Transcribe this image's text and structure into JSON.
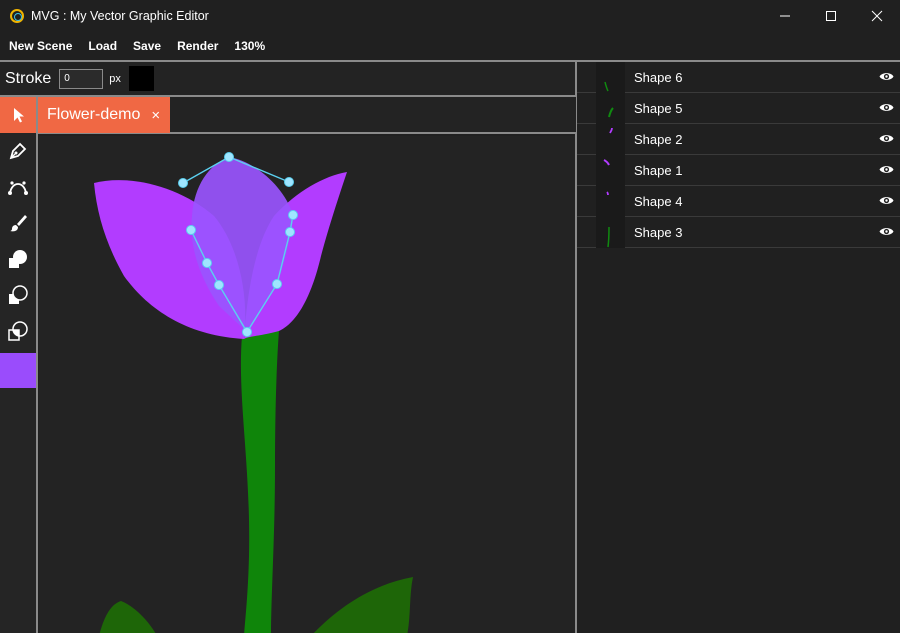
{
  "window": {
    "title": "MVG : My Vector Graphic Editor"
  },
  "menu": {
    "items": [
      "New Scene",
      "Load",
      "Save",
      "Render",
      "130%"
    ]
  },
  "toolbar": {
    "stroke_label": "Stroke",
    "stroke_value": "0",
    "stroke_unit": "px",
    "stroke_color": "#000000"
  },
  "tools": [
    "select-tool-icon",
    "pen-tool-icon",
    "bezier-tool-icon",
    "brush-tool-icon",
    "shape-tool-icon",
    "stroke-fill-icon",
    "boolean-shape-icon"
  ],
  "fill_color": "#9a4cfc",
  "tab": {
    "label": "Flower-demo",
    "close": "×"
  },
  "shapes": [
    {
      "name": "Shape 6",
      "color": "#108a10"
    },
    {
      "name": "Shape 5",
      "color": "#108a10"
    },
    {
      "name": "Shape 2",
      "color": "#b23cff"
    },
    {
      "name": "Shape 1",
      "color": "#b23cff"
    },
    {
      "name": "Shape 4",
      "color": "#b23cff"
    },
    {
      "name": "Shape 3",
      "color": "#108a10"
    }
  ],
  "colors": {
    "accent": "#f06844",
    "petal": "#b23cff",
    "petal_selected": "#9a55ff",
    "stem": "#0f850a",
    "leaf": "#1e6608",
    "handle": "#5bd0f0"
  }
}
